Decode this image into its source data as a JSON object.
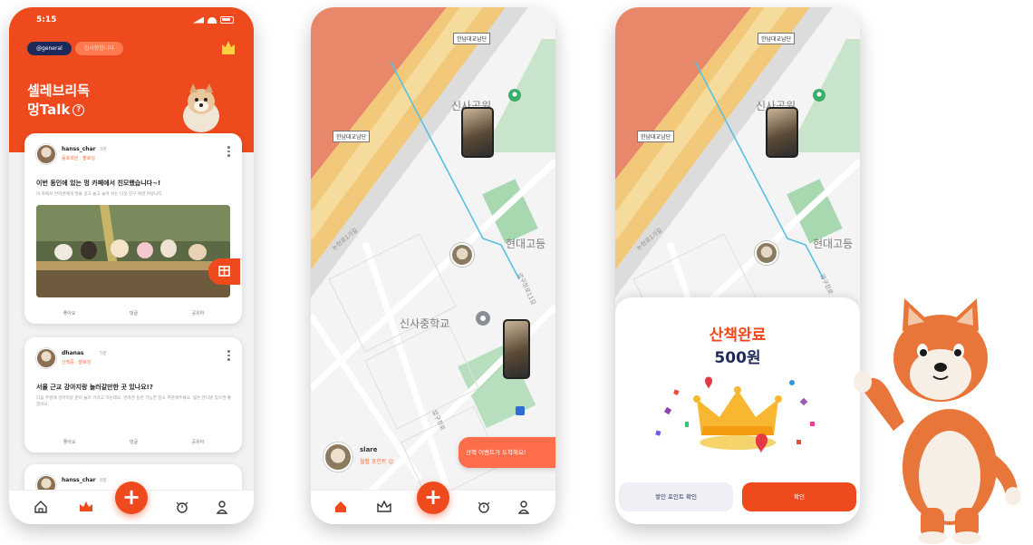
{
  "feed_screen": {
    "status_time": "5:15",
    "channel_tabs": [
      {
        "label": "@general"
      },
      {
        "label": "김사랑합니다"
      }
    ],
    "title_line1": "셀레브리독",
    "title_line2": "멍Talk",
    "help_glyph": "?",
    "posts": [
      {
        "username": "hanss_char",
        "time": "3분",
        "badge": "동호회원 · 팔로잉",
        "title": "이번 동인에 있는 멍 카페에서 친모했습니다~!",
        "body": "이 쪽에서 반려견에게 발을 길고 놀고 놀며 쉬는 다섯 친구 애견 커뮤니티",
        "actions": [
          "좋아요",
          "댓글",
          "공유하"
        ]
      },
      {
        "username": "dhanas",
        "time": "5분",
        "badge": "산책중 · 팔로잉",
        "title": "서울 근교 강아지랑 놀러갈만한 곳 있나요!?",
        "body": "다음 주말에 강아지랑 같이 놀러 가려고 하는데요, 반려견 동반 가능한 장소 추천해주세요. 넓은 잔디밭 있으면 좋겠어요.",
        "actions": [
          "좋아요",
          "댓글",
          "공유하"
        ]
      },
      {
        "username": "hanss_char",
        "time": "8분"
      }
    ],
    "fab_label": "+"
  },
  "map_screen": {
    "labels": {
      "bridge_top": "한남대교남단",
      "bridge_left": "한남대교남단",
      "park": "신사공원",
      "school": "신사중학교",
      "field": "현대고등",
      "street_1": "논현로1가길",
      "street_2": "압구정로11길",
      "street_3": "압구정로"
    },
    "walker": {
      "name": "slare",
      "status": "월활 포인트 😊"
    },
    "toast": "산책 이벤트가 도착해요!",
    "fab_label": "+"
  },
  "reward_screen": {
    "labels": {
      "bridge_top": "한남대교남단",
      "bridge_left": "한남대교남단",
      "park": "신사공원",
      "field": "현대고등",
      "street_1": "논현로1가길",
      "street_2": "압구정로"
    },
    "title": "산책완료",
    "amount": "500원",
    "secondary_button": "쌓인 포인트 확인",
    "primary_button": "확인"
  },
  "colors": {
    "brand": "#ef4a1d",
    "navy": "#1f2a5c",
    "toast": "#ff6d4a",
    "walk_route": "#56c1e0"
  }
}
